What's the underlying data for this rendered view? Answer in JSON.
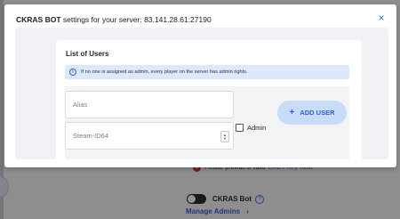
{
  "modal": {
    "title_bold": "CKRAS BOT",
    "title_rest": " settings for your server: 83.141.28.61:27190",
    "close_icon": "×",
    "list_heading": "List of Users",
    "info_icon": "i",
    "info_text": "If no one is assigned as admin, every player on the server has admin rights.",
    "alias_placeholder": "Alias",
    "steam_placeholder": "Steam-ID64",
    "stepper_up": "▲",
    "stepper_down": "▼",
    "admin_label": "Admin",
    "add_user_icon": "+",
    "add_user_label": "ADD USER"
  },
  "background": {
    "error_icon": "×",
    "warning_text": "Please provide a valid",
    "warning_link": "CKCY Key",
    "warning_tail": "here",
    "bot_label": "CKRAS Bot",
    "help_icon": "?",
    "manage_admins": "Manage Admins",
    "manage_chevron": "›"
  },
  "colors": {
    "accent": "#2f5fd0",
    "info_bg": "#dfe7fa",
    "button_bg": "#c9dcf7",
    "error": "#d33a2f"
  }
}
